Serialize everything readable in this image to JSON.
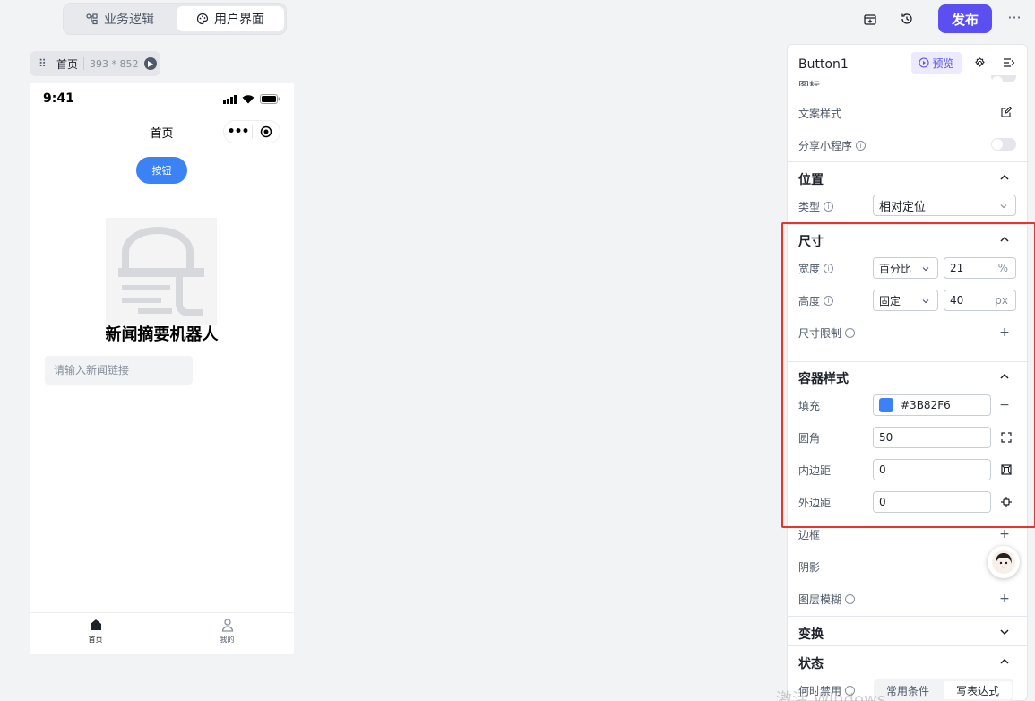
{
  "topbar": {
    "tab_logic": "业务逻辑",
    "tab_ui": "用户界面",
    "publish": "发布",
    "more": "···"
  },
  "canvas": {
    "page_name": "首页",
    "page_size": "393 * 852"
  },
  "phone": {
    "time": "9:41",
    "nav_title": "首页",
    "button_label": "按钮",
    "title": "新闻摘要机器人",
    "input_placeholder": "请输入新闻链接",
    "tabs": [
      "首页",
      "我的"
    ]
  },
  "panel": {
    "component_name": "Button1",
    "preview": "预览",
    "cut_label": "图标",
    "text_style": "文案样式",
    "share_mini": "分享小程序",
    "position": {
      "title": "位置",
      "type_label": "类型",
      "type_value": "相对定位"
    },
    "size": {
      "title": "尺寸",
      "width_label": "宽度",
      "width_mode": "百分比",
      "width_value": "21",
      "width_unit": "%",
      "height_label": "高度",
      "height_mode": "固定",
      "height_value": "40",
      "height_unit": "px",
      "limit_label": "尺寸限制"
    },
    "container": {
      "title": "容器样式",
      "fill_label": "填充",
      "fill_value": "#3B82F6",
      "radius_label": "圆角",
      "radius_value": "50",
      "padding_label": "内边距",
      "padding_value": "0",
      "margin_label": "外边距",
      "margin_value": "0"
    },
    "border_label": "边框",
    "shadow_label": "阴影",
    "blur_label": "图层模糊",
    "transform_title": "变换",
    "state_title": "状态",
    "disable_label": "何时禁用",
    "cond_common": "常用条件",
    "cond_expr": "写表达式"
  },
  "watermark": "激活 Windows",
  "colors": {
    "accent": "#5B4FF2",
    "button_blue": "#3B82F6",
    "highlight": "#E5352C"
  }
}
